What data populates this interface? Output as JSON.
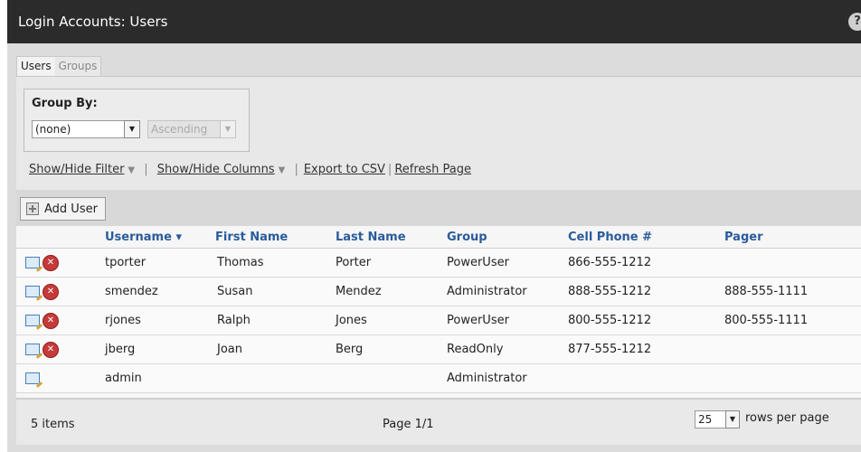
{
  "header": {
    "title": "Login Accounts: Users",
    "help": "?"
  },
  "tabs": [
    {
      "label": "Users",
      "active": true
    },
    {
      "label": "Groups",
      "active": false
    }
  ],
  "group_by": {
    "label": "Group By:",
    "selected": "(none)",
    "order": "Ascending"
  },
  "links": {
    "filter": "Show/Hide Filter",
    "columns": "Show/Hide Columns",
    "export": "Export to CSV",
    "refresh": "Refresh Page"
  },
  "toolbar": {
    "add_user": "Add User"
  },
  "table": {
    "columns": [
      "Username ▾",
      "First Name",
      "Last Name",
      "Group",
      "Cell Phone #",
      "Pager"
    ],
    "rows": [
      [
        "tporter",
        "Thomas",
        "Porter",
        "PowerUser",
        "866-555-1212",
        ""
      ],
      [
        "smendez",
        "Susan",
        "Mendez",
        "Administrator",
        "888-555-1212",
        "888-555-1111"
      ],
      [
        "rjones",
        "Ralph",
        "Jones",
        "PowerUser",
        "800-555-1212",
        "800-555-1111"
      ],
      [
        "jberg",
        "Joan",
        "Berg",
        "ReadOnly",
        "877-555-1212",
        ""
      ],
      [
        "admin",
        "",
        "",
        "Administrator",
        "",
        ""
      ]
    ]
  },
  "footer": {
    "items": "5 items",
    "page": "Page 1/1",
    "rows_per_page": "25",
    "rows_per_page_label": "rows per page"
  },
  "colors": {
    "titlebar": "#2b2b2b",
    "link_header": "#2a5b9a",
    "delete": "#c63a3a"
  }
}
